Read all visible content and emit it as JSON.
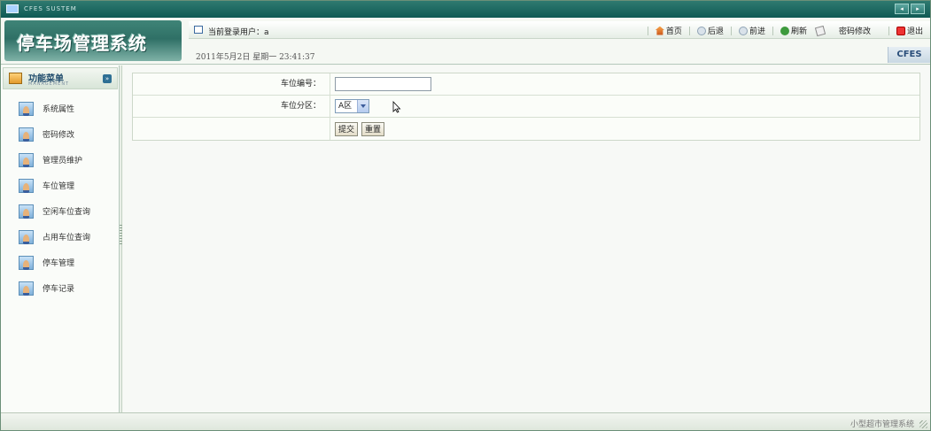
{
  "window": {
    "title": "CFES SUSTEM",
    "controls": [
      "◂",
      "▸"
    ]
  },
  "header": {
    "logo_text": "停车场管理系统",
    "current_user_label": "当前登录用户：a",
    "datetime": "2011年5月2日 星期一 23:41:37",
    "brand": "CFES",
    "toolbar": {
      "home": "首页",
      "back": "后退",
      "forward": "前进",
      "refresh": "刷新",
      "change_password": "密码修改",
      "exit": "退出"
    }
  },
  "sidebar": {
    "title": "功能菜单",
    "subtitle": "MANAGEMENT",
    "collapse_icon": "»",
    "items": [
      {
        "label": "系统属性"
      },
      {
        "label": "密码修改"
      },
      {
        "label": "管理员维护"
      },
      {
        "label": "车位管理"
      },
      {
        "label": "空闲车位查询"
      },
      {
        "label": "占用车位查询"
      },
      {
        "label": "停车管理"
      },
      {
        "label": "停车记录"
      }
    ]
  },
  "form": {
    "space_number_label": "车位编号：",
    "space_number_value": "",
    "zone_label": "车位分区：",
    "zone_selected": "A区",
    "submit_label": "提交",
    "reset_label": "重置"
  },
  "statusbar": {
    "text": "小型超市管理系统"
  },
  "colors": {
    "titlebar": "#0f5a55",
    "logo": "#2f7066",
    "brand_text": "#2a4e7a"
  }
}
